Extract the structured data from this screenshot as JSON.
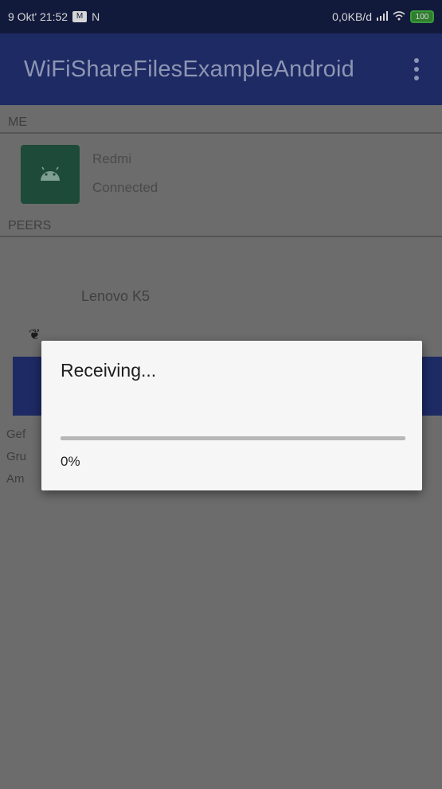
{
  "status_bar": {
    "left_text": "9 Okt' 21:52",
    "left_icon_1": "M",
    "left_icon_2": "N",
    "right_text": "0,0KB/d",
    "battery_level": "100"
  },
  "app_bar": {
    "title": "WiFiShareFilesExampleAndroid"
  },
  "me_section": {
    "header": "ME",
    "device_name": "Redmi",
    "device_status": "Connected"
  },
  "peers_section": {
    "header": "PEERS",
    "peers": [
      "Lenovo K5"
    ]
  },
  "background_partial": {
    "line_1": "Gef",
    "line_2": "Gru",
    "line_3": "Am"
  },
  "dialog": {
    "title": "Receiving...",
    "progress_text": "0%",
    "progress_fraction": 0
  },
  "colors": {
    "app_bar": "#1d2a63",
    "status_bar": "#121a3c",
    "dialog_bg": "#f6f6f6",
    "progress_track": "#b7b7b7"
  },
  "icons": {
    "more_options": "vertical-dots",
    "android_avatar": "android-robot",
    "wifi": "wifi",
    "signal": "signal-bars",
    "battery": "battery"
  }
}
